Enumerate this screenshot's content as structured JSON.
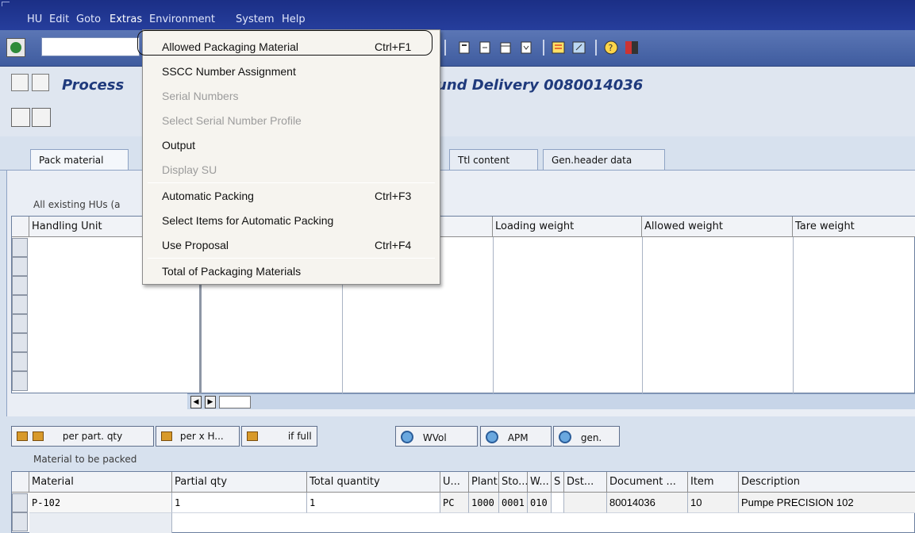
{
  "menubar": {
    "items": [
      "HU",
      "Edit",
      "Goto",
      "Extras",
      "Environment",
      "System",
      "Help"
    ],
    "active": "Extras"
  },
  "title": {
    "left": "Process",
    "right": "und Delivery 0080014036"
  },
  "tabs": [
    {
      "label": "Pack material"
    },
    {
      "label": "Ttl content"
    },
    {
      "label": "Gen.header data"
    }
  ],
  "hu_section": {
    "label": "All existing HUs (a",
    "headers": [
      "Handling Unit",
      "Loading weight",
      "Allowed weight",
      "Tare weight"
    ]
  },
  "lower_toolbar": {
    "btn_per_part": "per part. qty",
    "btn_per_x": "per x H...",
    "btn_if_full": "if full",
    "btn_wvol": "WVol",
    "btn_apm": "APM",
    "btn_gen": "gen."
  },
  "material_section": {
    "label": "Material to be packed",
    "headers": [
      "Material",
      "Partial qty",
      "Total quantity",
      "U...",
      "Plant",
      "Sto...",
      "W...",
      "S",
      "Dst...",
      "Document ...",
      "Item",
      "Description"
    ],
    "row": [
      "P-102",
      "1",
      "1",
      "PC",
      "1000",
      "0001",
      "010",
      "",
      "",
      "80014036",
      "10",
      "Pumpe PRECISION 102"
    ]
  },
  "extras_menu": {
    "items": [
      {
        "label": "Allowed Packaging Material",
        "shortcut": "Ctrl+F1",
        "enabled": true
      },
      {
        "label": "SSCC Number Assignment",
        "shortcut": "",
        "enabled": true
      },
      {
        "label": "Serial Numbers",
        "shortcut": "",
        "enabled": false
      },
      {
        "label": "Select Serial Number Profile",
        "shortcut": "",
        "enabled": false
      },
      {
        "label": "Output",
        "shortcut": "",
        "enabled": true
      },
      {
        "label": "Display SU",
        "shortcut": "",
        "enabled": false
      },
      {
        "label": "Automatic Packing",
        "shortcut": "Ctrl+F3",
        "enabled": true
      },
      {
        "label": "Select Items for Automatic Packing",
        "shortcut": "",
        "enabled": true
      },
      {
        "label": "Use Proposal",
        "shortcut": "Ctrl+F4",
        "enabled": true
      },
      {
        "label": "Total of Packaging Materials",
        "shortcut": "",
        "enabled": true
      }
    ]
  },
  "colors": {
    "menubar": "#1b2f86",
    "toolbar": "#4a66a8",
    "title": "#1f3a7c",
    "workspace": "#d7e1ee"
  }
}
